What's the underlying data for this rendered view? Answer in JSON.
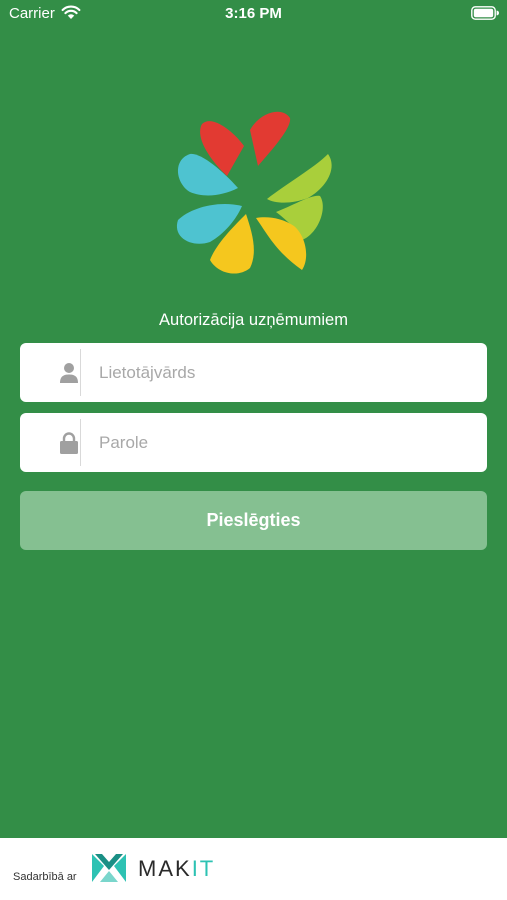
{
  "status_bar": {
    "carrier": "Carrier",
    "time": "3:16 PM"
  },
  "login": {
    "subtitle": "Autorizācija uzņēmumiem",
    "username_placeholder": "Lietotājvārds",
    "username_value": "",
    "password_placeholder": "Parole",
    "password_value": "",
    "submit_label": "Pieslēgties"
  },
  "footer": {
    "partner_text": "Sadarbībā ar",
    "brand_part1": "MAK",
    "brand_part2": "IT"
  },
  "colors": {
    "background": "#338e47",
    "button": "#85c091",
    "petal_red": "#e23a32",
    "petal_cyan": "#4ec3d0",
    "petal_lime": "#a9cf3b",
    "petal_yellow": "#f5c71e",
    "brand_accent": "#2dc2b3"
  },
  "icons": {
    "wifi": "wifi-icon",
    "battery": "battery-icon",
    "user": "user-icon",
    "lock": "lock-icon",
    "logo": "four-leaf-clover-logo",
    "partner": "makit-logo-icon"
  }
}
